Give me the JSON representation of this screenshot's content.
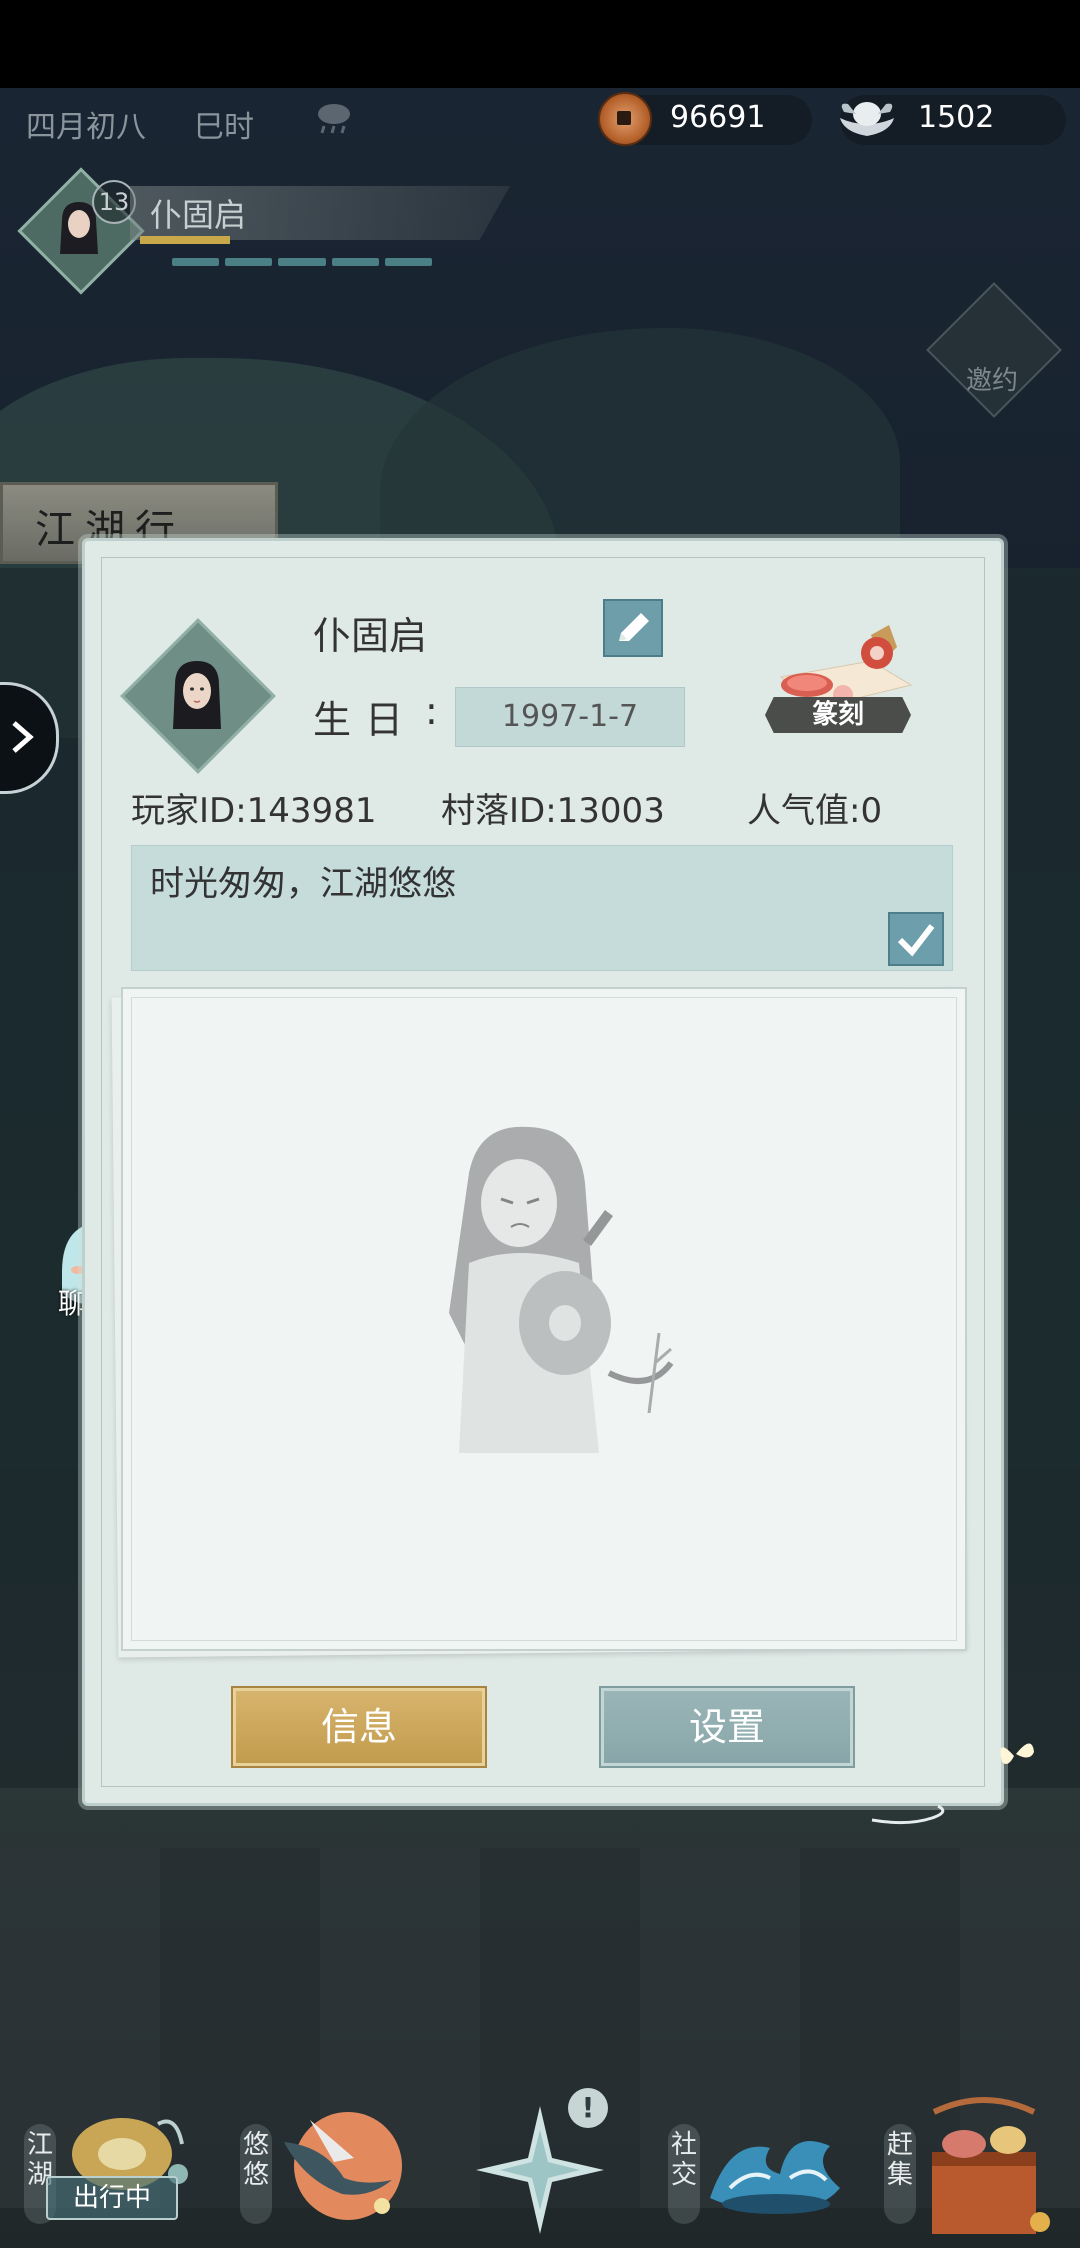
{
  "status_bar": {},
  "top_bar": {
    "date": "四月初八",
    "hour": "巳时",
    "weather_icon": "cloud-rain-icon",
    "copper": "96691",
    "silver": "1502"
  },
  "player": {
    "level": "13",
    "name": "仆固启"
  },
  "side": {
    "invite_label": "邀约",
    "jianghu_sign": "江湖行",
    "chat_label": "聊天"
  },
  "profile": {
    "name": "仆固启",
    "birthday_label": "生日",
    "birthday_colon": ":",
    "birthday_value": "1997-1-7",
    "seal_label": "篆刻",
    "player_id": "玩家ID:143981",
    "village_id": "村落ID:13003",
    "popularity": "人气值:0",
    "signature": "时光匆匆，江湖悠悠",
    "info_button": "信息",
    "settings_button": "设置"
  },
  "bottom_nav": {
    "jianghu": "江湖",
    "traveling": "出行中",
    "youyou": "悠悠",
    "social": "社交",
    "market": "赶集"
  },
  "colors": {
    "panel_bg": "#dfe9e6",
    "info_button": "#c9a453",
    "settings_button": "#8fabad",
    "field_bg": "#c6dcdb"
  }
}
